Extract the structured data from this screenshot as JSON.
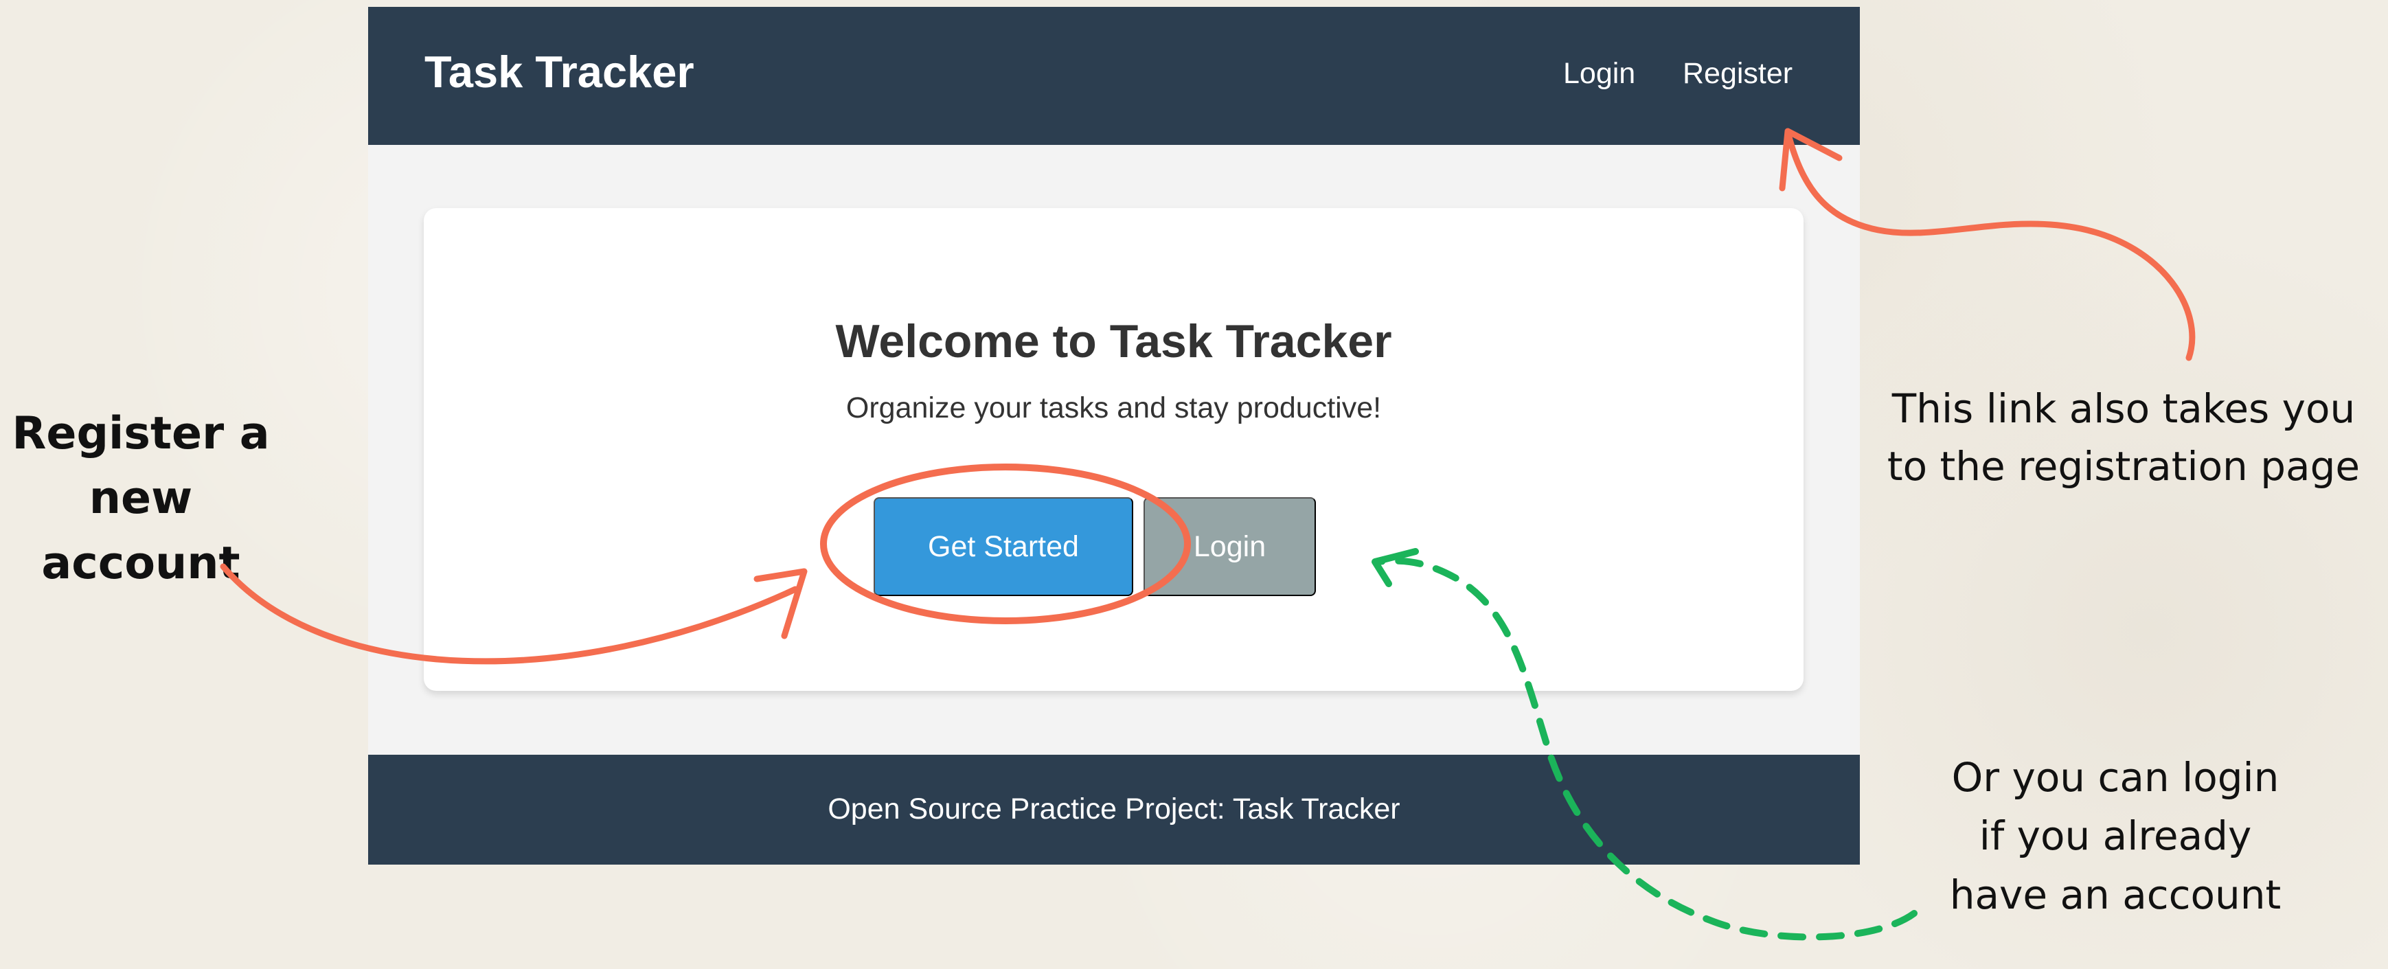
{
  "app": {
    "brand": "Task Tracker",
    "nav": {
      "login": "Login",
      "register": "Register"
    },
    "hero": {
      "title": "Welcome to Task Tracker",
      "subtitle": "Organize your tasks and stay productive!",
      "primary_button": "Get Started",
      "secondary_button": "Login"
    },
    "footer": "Open Source Practice Project: Task Tracker"
  },
  "annotations": {
    "register_new_account": "Register a new account",
    "registration_link_note": "This link also takes you to the registration page",
    "login_note": "Or you can login if you already have an account"
  },
  "colors": {
    "background": "#f1ede4",
    "header_footer": "#2c3e50",
    "card_background": "#ffffff",
    "primary_button": "#3498db",
    "secondary_button": "#95a5a6",
    "annotation_orange": "#f46d4f",
    "annotation_green": "#1bb45a"
  },
  "icons": {
    "register_link_arrow": "curved-orange-arrow",
    "register_button_highlight": "orange-circle-highlight",
    "login_button_arrow": "green-dashed-arrow"
  }
}
